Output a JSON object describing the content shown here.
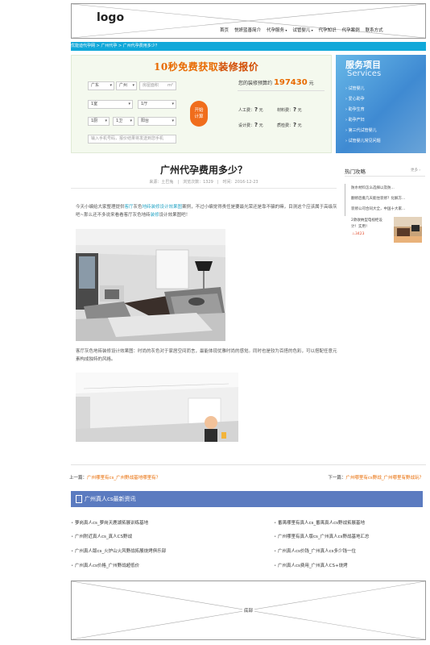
{
  "header": {
    "logo": "logo",
    "nav": [
      {
        "label": "首页",
        "dropdown": false
      },
      {
        "label": "悦妍蓝善简介",
        "dropdown": false
      },
      {
        "label": "代孕服务",
        "dropdown": true
      },
      {
        "label": "试管婴儿",
        "dropdown": true
      },
      {
        "label": "代孕知识",
        "dropdown": false
      },
      {
        "label": "代孕案例",
        "dropdown": false
      },
      {
        "label": "联系方式",
        "dropdown": false
      }
    ]
  },
  "breadcrumb": "优能迪代孕网 > 广州代孕 > 广州代孕费用多少？",
  "quote": {
    "title_plain": "10秒免费获取",
    "title_highlight": "装修报价",
    "fields": {
      "province": "广东",
      "city": "广州",
      "area_placeholder": "房屋面积",
      "area_unit": "m²",
      "rooms": "1室",
      "halls": "1厅",
      "kitchens": "1厨",
      "baths": "1卫",
      "balcony": "阳台",
      "phone_placeholder": "输入手机号码，报价结果将发送到您手机"
    },
    "calc_label_1": "开始",
    "calc_label_2": "计算",
    "budget_label": "您的装修预算约",
    "budget_value": "197430",
    "budget_unit": "元",
    "costs": [
      {
        "label": "人工费：",
        "value": "?",
        "unit": "元"
      },
      {
        "label": "材料费：",
        "value": "?",
        "unit": "元"
      },
      {
        "label": "设计费：",
        "value": "?",
        "unit": "元"
      },
      {
        "label": "质检费：",
        "value": "?",
        "unit": "元"
      }
    ]
  },
  "services": {
    "title": "服务项目",
    "subtitle": "Services",
    "items": [
      "试管婴儿",
      "爱心助孕",
      "助孕生育",
      "助孕产妇",
      "第三代试管婴儿",
      "试管婴儿常见问题"
    ]
  },
  "article": {
    "title": "广州代孕费用多少？",
    "meta": "来源：土巴兔　|　浏览次数：1329　|　时间：2016-12-23",
    "intro_1": "今天小编给大家整理提供",
    "intro_link_1": "客厅",
    "intro_2": "灰色",
    "intro_link_2": "地砖装修设计效果图",
    "intro_3": "案例，不过小编觉得责任是要最光荣还是靠不骗的嘛，目测这个应该属于高级灰吧~那么还不多说来看看客厅灰色地砖",
    "intro_link_3": "装修",
    "intro_4": "设计效果图吧！",
    "caption": "客厅灰色地砖装修设计效果图：时尚的灰色对于家居空间而言，最能体现优雅时尚的感觉。同时也是较为百搭的色彩，可以搭配任意元素构成独特的风格。"
  },
  "hot_news": {
    "title": "热门攻略",
    "more": "更多 ›",
    "items": [
      "防水材料怎么选择以及防...",
      "翻修后搬几天能住装修？化解方...",
      "装修公司合同大全，中国十大家...",
      "2款收纳型电视柜设",
      "计！实用！"
    ],
    "count": "3423"
  },
  "prev_next": {
    "prev_label": "上一篇：",
    "prev_link": "广州哪里有cs_广州野战基地哪里有？",
    "next_label": "下一篇：",
    "next_link": "广州哪里有cs野战_广州哪里有野战玩？"
  },
  "news": {
    "title": "广州真人cs最新资讯",
    "left": [
      "萝岗真人cs_萝岗天鹿湖拓展训练基地",
      "广州附近真人cs_真人CS野战",
      "广州真人版cs_火炉山火风野战拓展烧烤俱乐部",
      "广州真人cs价格_广州野战超低价"
    ],
    "right": [
      "番禺哪里有真人cs_番禺真人cs野战拓展基地",
      "广州哪里有真人版cs_广州真人cs野战基地汇总",
      "广州真人cs价钱_广州真人cs多少钱一位",
      "广州真人cs费用_广州真人CS+烧烤"
    ]
  },
  "footer": {
    "label": "底部"
  },
  "colors": {
    "accent_blue": "#11a8d9",
    "accent_orange": "#e86a00",
    "news_head": "#5b7bc0"
  }
}
